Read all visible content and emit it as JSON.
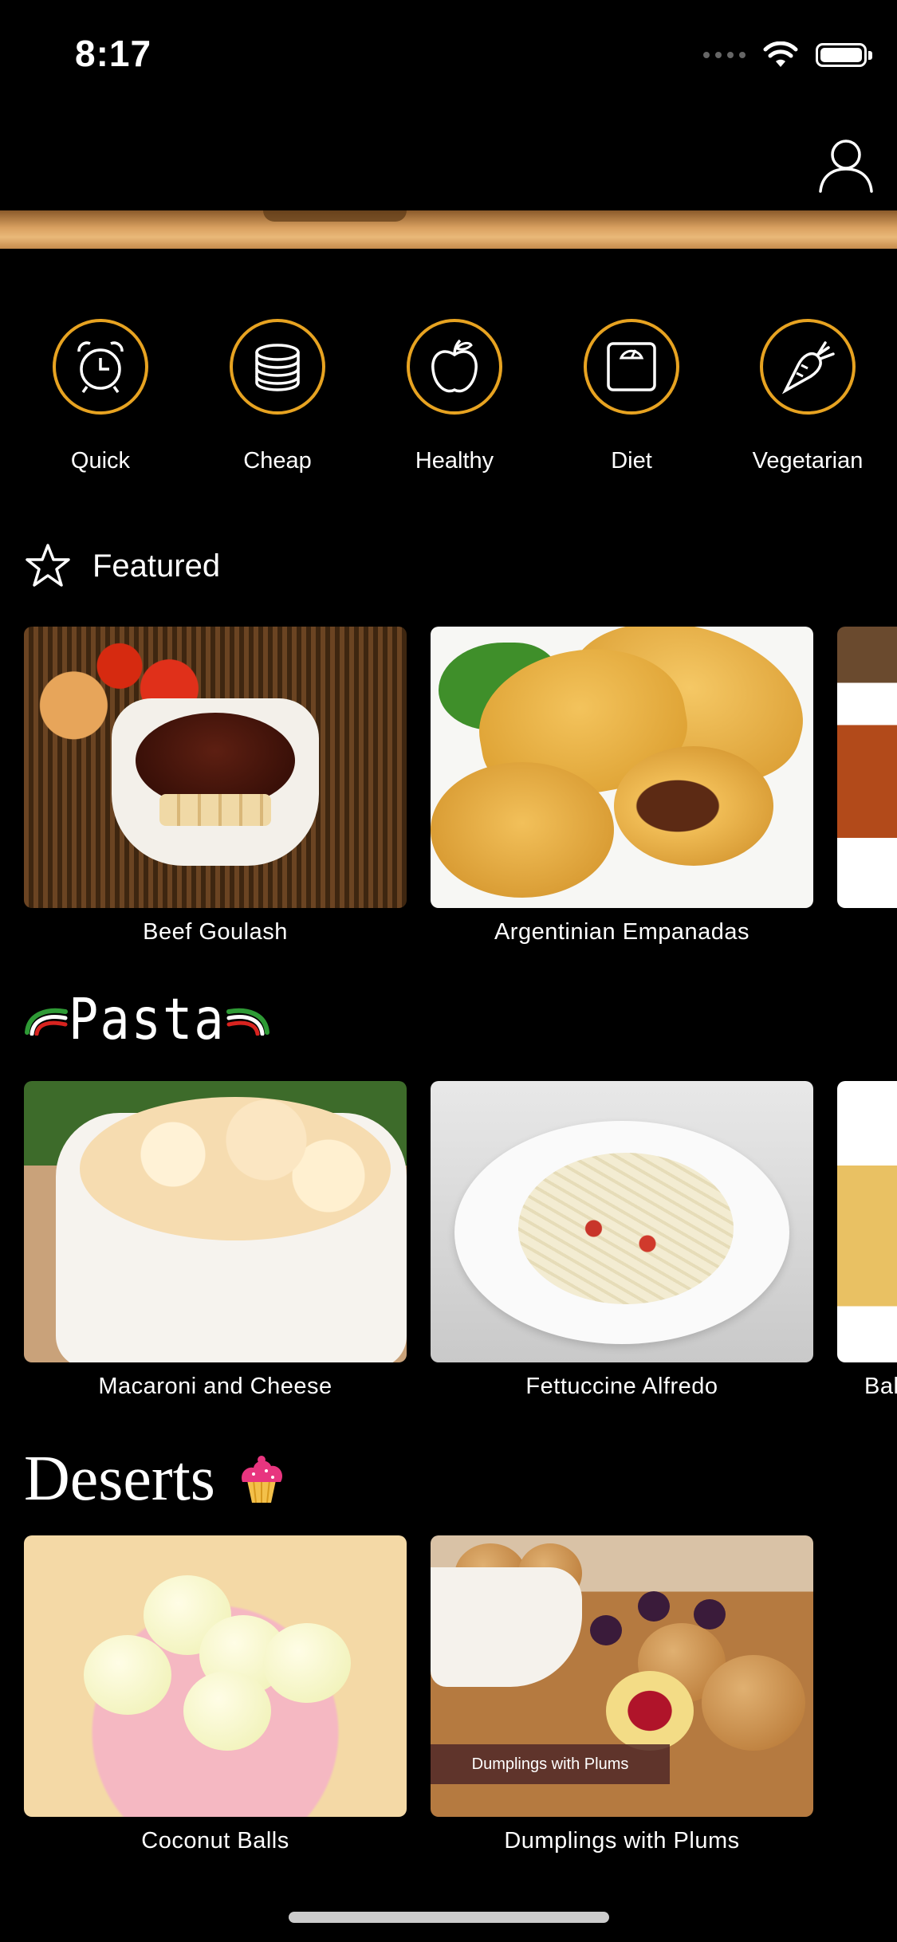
{
  "status_bar": {
    "time": "8:17",
    "icons": [
      "signal-icon",
      "wifi-icon",
      "battery-icon"
    ]
  },
  "header": {
    "profile_icon": "person-icon"
  },
  "categories": [
    {
      "label": "Quick",
      "icon": "alarm-clock-icon"
    },
    {
      "label": "Cheap",
      "icon": "coins-icon"
    },
    {
      "label": "Healthy",
      "icon": "apple-icon"
    },
    {
      "label": "Diet",
      "icon": "scale-icon"
    },
    {
      "label": "Vegetarian",
      "icon": "carrot-icon"
    }
  ],
  "featured": {
    "title": "Featured",
    "items": [
      {
        "name": "Beef Goulash"
      },
      {
        "name": "Argentinian Empanadas"
      },
      {
        "name": ""
      }
    ]
  },
  "pasta": {
    "title": "Pasta",
    "items": [
      {
        "name": "Macaroni and Cheese"
      },
      {
        "name": "Fettuccine Alfredo"
      },
      {
        "name": "Bal"
      }
    ]
  },
  "deserts": {
    "title": "Deserts",
    "items": [
      {
        "name": "Coconut Balls"
      },
      {
        "name": "Dumplings with Plums",
        "image_tag": "Dumplings with Plums"
      }
    ]
  },
  "colors": {
    "background": "#000000",
    "accent": "#e7a321",
    "text": "#ffffff"
  }
}
